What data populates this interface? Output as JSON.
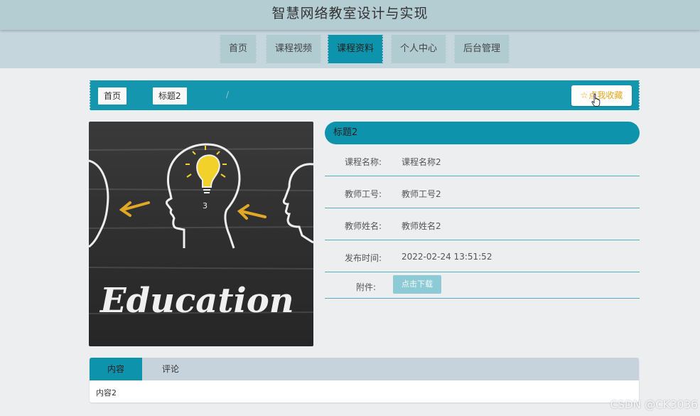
{
  "header": {
    "title": "智慧网络教室设计与实现"
  },
  "nav": {
    "items": [
      {
        "label": "首页",
        "active": false
      },
      {
        "label": "课程视频",
        "active": false
      },
      {
        "label": "课程资料",
        "active": true
      },
      {
        "label": "个人中心",
        "active": false
      },
      {
        "label": "后台管理",
        "active": false
      }
    ]
  },
  "breadcrumb": {
    "home": "首页",
    "separator": "/",
    "current": "标题2"
  },
  "favorite": {
    "label": "点我收藏",
    "icon": "star-icon"
  },
  "image": {
    "text": "Education"
  },
  "detail": {
    "title": "标题2",
    "rows": [
      {
        "label": "课程名称:",
        "value": "课程名称2"
      },
      {
        "label": "教师工号:",
        "value": "教师工号2"
      },
      {
        "label": "教师姓名:",
        "value": "教师姓名2"
      },
      {
        "label": "发布时间:",
        "value": "2022-02-24 13:51:52"
      }
    ],
    "attachment": {
      "label": "附件:",
      "button": "点击下载"
    }
  },
  "tabs": {
    "items": [
      {
        "label": "内容",
        "active": true
      },
      {
        "label": "评论",
        "active": false
      }
    ],
    "content": "内容2"
  },
  "watermark": "CSDN @CK3036",
  "colors": {
    "accent": "#0e93ac",
    "header_bg": "#b4cdd3",
    "nav_bg": "#c5d7dd",
    "favorite_text": "#e5a71e",
    "download_bg": "#8ccbd6"
  }
}
